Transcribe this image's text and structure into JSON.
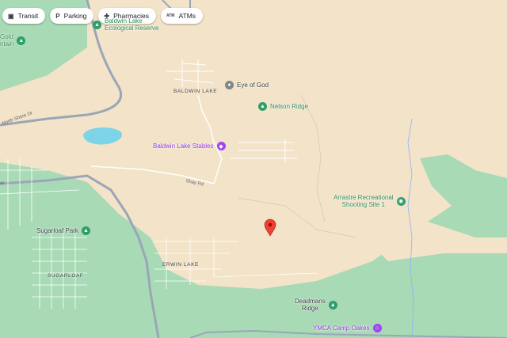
{
  "chips": [
    {
      "icon": "transit-icon",
      "glyph": "▣",
      "label": "Transit"
    },
    {
      "icon": "parking-icon",
      "glyph": "P",
      "label": "Parking"
    },
    {
      "icon": "pharmacy-icon",
      "glyph": "✚",
      "label": "Pharmacies"
    },
    {
      "icon": "atm-icon",
      "glyph": "ATM",
      "label": "ATMs"
    }
  ],
  "places": {
    "gold_line1": "Gold",
    "gold_line2": "ntain",
    "ecological_line1": "Baldwin Lake",
    "ecological_line2": "Ecological Reserve",
    "eye_of_god": "Eye of God",
    "nelson_ridge": "Nelson Ridge",
    "stables": "Baldwin Lake Stables",
    "arrastre_line1": "Arrastre Recreational",
    "arrastre_line2": "Shooting Site 1",
    "sugarloaf_park": "Sugarloaf Park",
    "deadmans_line1": "Deadmans",
    "deadmans_line2": "Ridge",
    "ymca": "YMCA Camp Oakes"
  },
  "areas": {
    "baldwin_lake": "BALDWIN LAKE",
    "erwin_lake": "ERWIN LAKE",
    "sugarloaf": "SUGARLOAF"
  },
  "roads": {
    "north_shore": "North Shore Dr",
    "shay": "Shay Rd",
    "edge": "ar"
  },
  "colors": {
    "land": "#f3e3c8",
    "forest": "#a8dab5",
    "water": "#7dd3e8",
    "road": "#9aa6b8",
    "marker": "#ea4335"
  }
}
